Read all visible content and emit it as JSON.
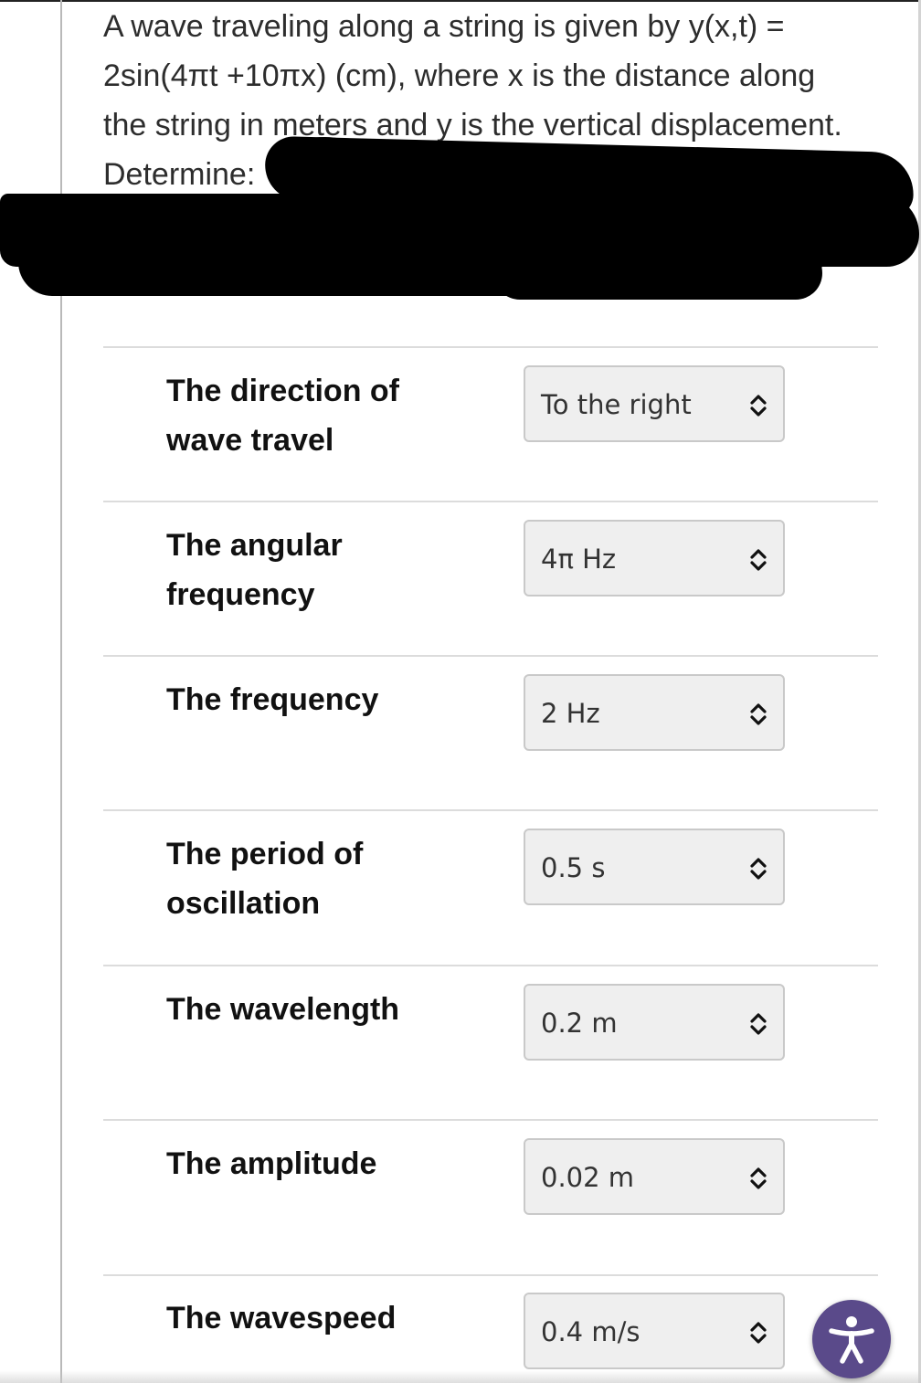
{
  "question": {
    "lines": [
      "A wave traveling along a string is given by y(x,t) =",
      "2sin(4πt +10πx) (cm), where x is the distance along",
      "the string in meters and y is the vertical displacement.",
      "Determine:"
    ]
  },
  "rows": [
    {
      "label": "The direction of wave travel",
      "value": "To the right"
    },
    {
      "label": "The angular frequency",
      "value": "4π Hz"
    },
    {
      "label": "The frequency",
      "value": "2 Hz"
    },
    {
      "label": "The period of oscillation",
      "value": "0.5 s"
    },
    {
      "label": "The wavelength",
      "value": "0.2 m"
    },
    {
      "label": "The amplitude",
      "value": "0.02 m"
    },
    {
      "label": "The wavespeed",
      "value": "0.4 m/s"
    }
  ],
  "colors": {
    "select_background": "#efefef",
    "select_border": "#c9c9c9",
    "accessibility_button": "#5a4a8a",
    "redaction": "#000000"
  }
}
